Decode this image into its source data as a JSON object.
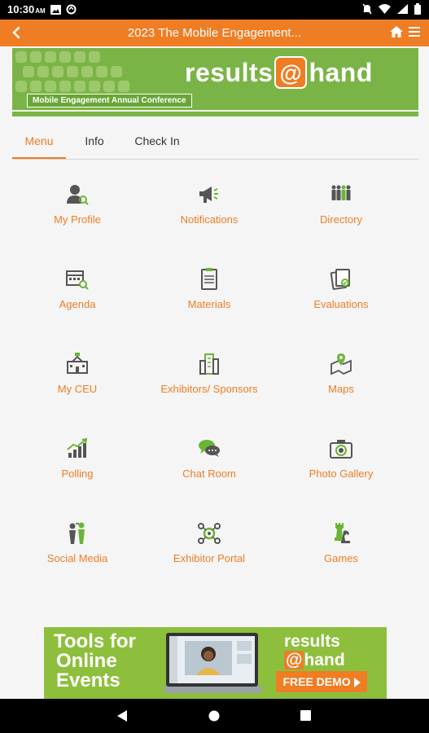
{
  "status_bar": {
    "time": "10:30",
    "ampm": "AM"
  },
  "app_bar": {
    "title": "2023 The Mobile Engagement..."
  },
  "banner": {
    "logo_left": "results",
    "logo_at": "@",
    "logo_right": "hand",
    "subtitle": "Mobile Engagement Annual Conference"
  },
  "tabs": [
    {
      "label": "Menu",
      "active": true
    },
    {
      "label": "Info",
      "active": false
    },
    {
      "label": "Check In",
      "active": false
    }
  ],
  "grid": [
    {
      "label": "My Profile",
      "icon": "profile-icon"
    },
    {
      "label": "Notifications",
      "icon": "megaphone-icon"
    },
    {
      "label": "Directory",
      "icon": "people-icon"
    },
    {
      "label": "Agenda",
      "icon": "calendar-icon"
    },
    {
      "label": "Materials",
      "icon": "document-icon"
    },
    {
      "label": "Evaluations",
      "icon": "evaluation-icon"
    },
    {
      "label": "My CEU",
      "icon": "school-icon"
    },
    {
      "label": "Exhibitors/ Sponsors",
      "icon": "buildings-icon"
    },
    {
      "label": "Maps",
      "icon": "map-icon"
    },
    {
      "label": "Polling",
      "icon": "chart-icon"
    },
    {
      "label": "Chat Room",
      "icon": "chat-icon"
    },
    {
      "label": "Photo Gallery",
      "icon": "camera-icon"
    },
    {
      "label": "Social Media",
      "icon": "social-icon"
    },
    {
      "label": "Exhibitor Portal",
      "icon": "gears-icon"
    },
    {
      "label": "Games",
      "icon": "chess-icon"
    }
  ],
  "ad": {
    "line1": "Tools for",
    "line2": "Online",
    "line3": "Events",
    "logo_top": "results",
    "logo_at": "@",
    "logo_bottom": "hand",
    "cta": "FREE DEMO"
  },
  "colors": {
    "accent": "#ee7d24",
    "green": "#7bb446"
  }
}
